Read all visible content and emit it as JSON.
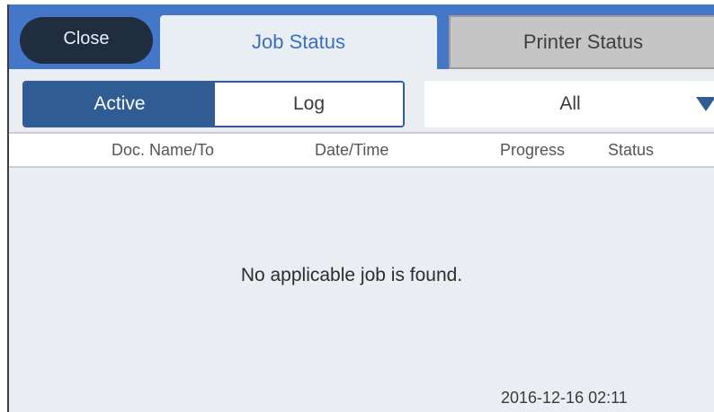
{
  "header": {
    "close_label": "Close",
    "tabs": [
      {
        "label": "Job Status",
        "selected": true
      },
      {
        "label": "Printer Status",
        "selected": false
      }
    ]
  },
  "filter": {
    "segments": [
      {
        "label": "Active",
        "selected": true
      },
      {
        "label": "Log",
        "selected": false
      }
    ],
    "dropdown_value": "All"
  },
  "table": {
    "columns": [
      "Doc. Name/To",
      "Date/Time",
      "Progress",
      "Status"
    ]
  },
  "main": {
    "empty_message": "No applicable job is found.",
    "timestamp": "2016-12-16 02:11"
  },
  "colors": {
    "header_bar": "#4477c7",
    "accent_dark": "#2f5d93",
    "tab_text": "#3a6fbf",
    "background": "#eaeef3"
  },
  "icons": {
    "dropdown": "triangle-down-icon"
  }
}
